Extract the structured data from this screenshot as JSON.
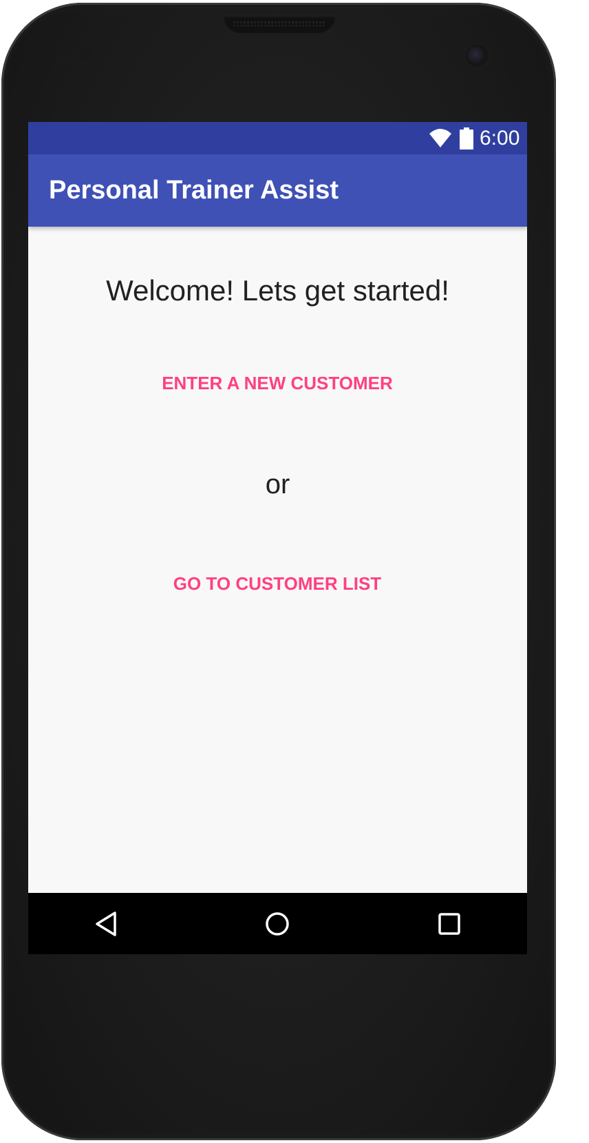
{
  "status_bar": {
    "time": "6:00",
    "icons": [
      "wifi-icon",
      "battery-icon"
    ]
  },
  "app_bar": {
    "title": "Personal Trainer Assist"
  },
  "main": {
    "welcome_text": "Welcome! Lets get started!",
    "new_customer_button": "ENTER A NEW CUSTOMER",
    "or_text": "or",
    "customer_list_button": "GO TO CUSTOMER LIST"
  },
  "nav_bar": {
    "buttons": [
      "back-icon",
      "home-icon",
      "recents-icon"
    ]
  },
  "colors": {
    "status_bar": "#303f9f",
    "app_bar": "#3f51b5",
    "accent": "#ff4081",
    "background": "#f8f8f8",
    "text_primary": "#212121"
  }
}
